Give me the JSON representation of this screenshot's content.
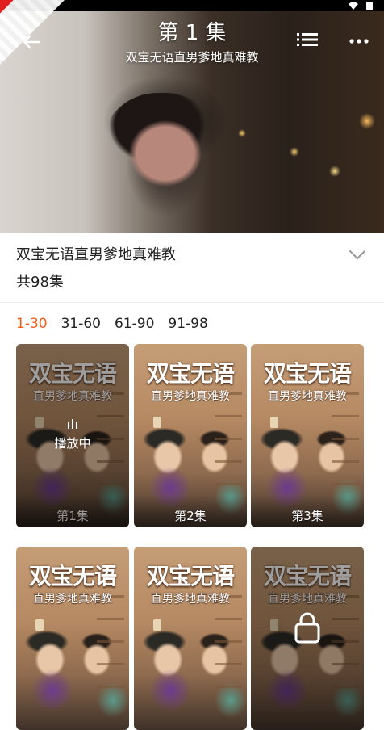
{
  "player": {
    "title": "第 1 集",
    "subtitle": "双宝无语直男爹地真难教",
    "icons": {
      "back": "back-arrow-icon",
      "list": "episode-list-icon",
      "more": "more-dots-icon"
    }
  },
  "info": {
    "drama_title": "双宝无语直男爹地真难教",
    "episode_count": "共98集",
    "expand_icon": "chevron-down-icon"
  },
  "ranges": [
    {
      "label": "1-30",
      "active": true
    },
    {
      "label": "31-60",
      "active": false
    },
    {
      "label": "61-90",
      "active": false
    },
    {
      "label": "91-98",
      "active": false
    }
  ],
  "cover": {
    "logo_main": "双宝无语",
    "logo_sub": "直男爹地真难教"
  },
  "episodes": [
    {
      "label": "第1集",
      "status": "playing",
      "status_text": "播放中"
    },
    {
      "label": "第2集",
      "status": "normal"
    },
    {
      "label": "第3集",
      "status": "normal"
    },
    {
      "label": "",
      "status": "normal"
    },
    {
      "label": "",
      "status": "normal"
    },
    {
      "label": "",
      "status": "locked"
    }
  ],
  "colors": {
    "accent": "#f25d1f",
    "text": "#222222"
  }
}
